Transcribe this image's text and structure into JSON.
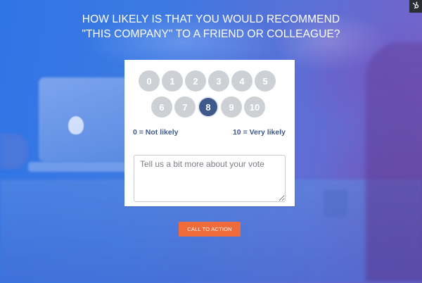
{
  "survey": {
    "question_line1": "HOW LIKELY IS THAT YOU WOULD RECOMMEND",
    "question_line2": "\"THIS COMPANY\" TO A FRIEND OR COLLEAGUE?",
    "scores_row1": [
      "0",
      "1",
      "2",
      "3",
      "4",
      "5"
    ],
    "scores_row2": [
      "6",
      "7",
      "8",
      "9",
      "10"
    ],
    "selected_score": "8",
    "low_label": "0 = Not likely",
    "high_label": "10 = Very likely",
    "feedback_placeholder": "Tell us a bit more about your vote",
    "feedback_value": "",
    "cta_label": "CALL TO ACTION"
  },
  "badge": {
    "icon": "hubspot-sprocket-icon"
  },
  "colors": {
    "background_blue": "#3f77e0",
    "background_purple": "#7a5fc6",
    "score_default": "#cdd1d6",
    "score_selected": "#3d5a8a",
    "label_text": "#3d5a8a",
    "cta": "#f06b3a"
  }
}
